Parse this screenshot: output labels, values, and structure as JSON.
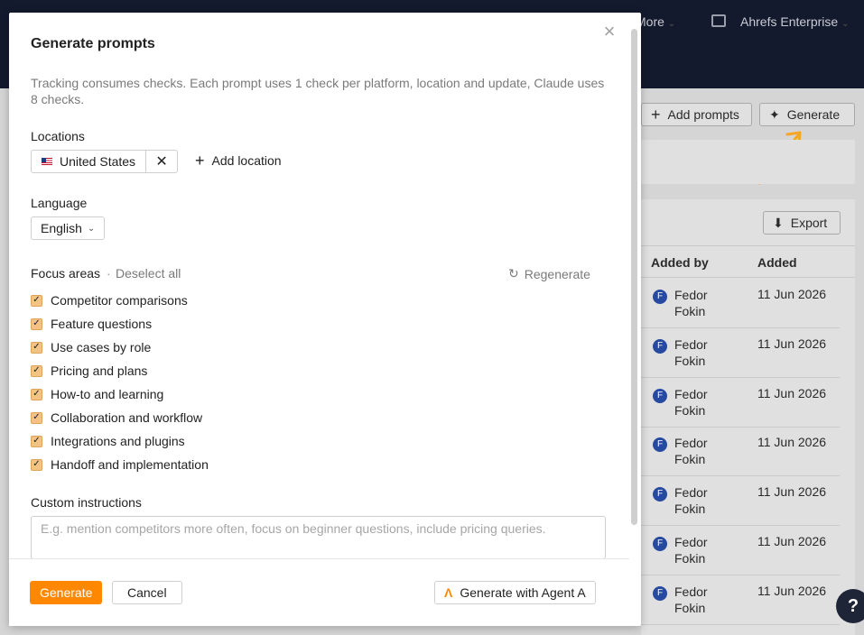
{
  "background": {
    "topbar": {
      "more_label": "More",
      "account": "Ahrefs Enterprise"
    },
    "toolbar": {
      "add_prompts": "Add prompts",
      "generate": "Generate"
    },
    "export_label": "Export",
    "table": {
      "headers": [
        "Added by",
        "Added"
      ],
      "rows": [
        {
          "first": "Fedor",
          "last": "Fokin",
          "initial": "F",
          "date": "11 Jun 2026"
        },
        {
          "first": "Fedor",
          "last": "Fokin",
          "initial": "F",
          "date": "11 Jun 2026"
        },
        {
          "first": "Fedor",
          "last": "Fokin",
          "initial": "F",
          "date": "11 Jun 2026"
        },
        {
          "first": "Fedor",
          "last": "Fokin",
          "initial": "F",
          "date": "11 Jun 2026"
        },
        {
          "first": "Fedor",
          "last": "Fokin",
          "initial": "F",
          "date": "11 Jun 2026"
        },
        {
          "first": "Fedor",
          "last": "Fokin",
          "initial": "F",
          "date": "11 Jun 2026"
        },
        {
          "first": "Fedor",
          "last": "Fokin",
          "initial": "F",
          "date": "11 Jun 2026"
        }
      ]
    },
    "help_label": "?",
    "arrow_color": "#f5a623"
  },
  "modal": {
    "title": "Generate prompts",
    "note": "Tracking consumes checks. Each prompt uses 1 check per platform, location and update, Claude uses 8 checks.",
    "locations_label": "Locations",
    "location_chip": "United States",
    "add_location": "Add location",
    "language_label": "Language",
    "language_value": "English",
    "focus_label": "Focus areas",
    "deselect_all": "Deselect all",
    "regenerate": "Regenerate",
    "focus_areas": [
      "Competitor comparisons",
      "Feature questions",
      "Use cases by role",
      "Pricing and plans",
      "How-to and learning",
      "Collaboration and workflow",
      "Integrations and plugins",
      "Handoff and implementation"
    ],
    "custom_label": "Custom instructions",
    "custom_placeholder": "E.g. mention competitors more often, focus on beginner questions, include pricing queries.",
    "generate_button": "Generate",
    "cancel_button": "Cancel",
    "agent_button": "Generate with Agent A",
    "accent_color": "#ff8800"
  }
}
